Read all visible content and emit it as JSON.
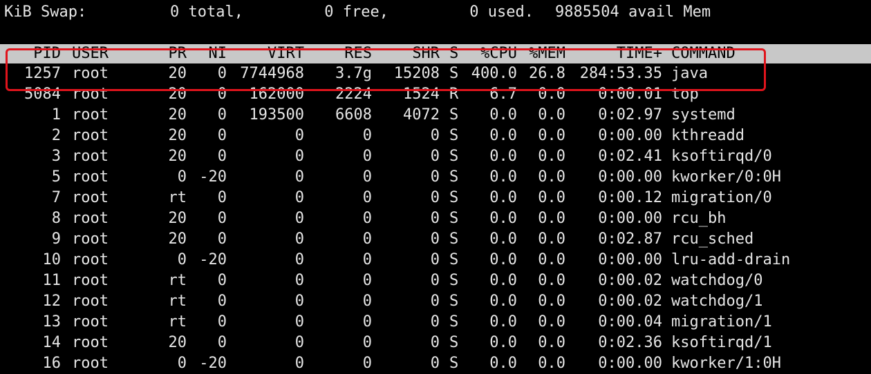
{
  "swap_summary": {
    "label": "KiB Swap:",
    "total": "0 total,",
    "free": "0 free,",
    "used": "0 used.",
    "avail": "9885504 avail Mem"
  },
  "columns": [
    "PID",
    "USER",
    "PR",
    "NI",
    "VIRT",
    "RES",
    "SHR",
    "S",
    "%CPU",
    "%MEM",
    "TIME+",
    "COMMAND"
  ],
  "processes": [
    [
      "1257",
      "root",
      "20",
      "0",
      "7744968",
      "3.7g",
      "15208",
      "S",
      "400.0",
      "26.8",
      "284:53.35",
      "java"
    ],
    [
      "5084",
      "root",
      "20",
      "0",
      "162000",
      "2224",
      "1524",
      "R",
      "6.7",
      "0.0",
      "0:00.01",
      "top"
    ],
    [
      "1",
      "root",
      "20",
      "0",
      "193500",
      "6608",
      "4072",
      "S",
      "0.0",
      "0.0",
      "0:02.97",
      "systemd"
    ],
    [
      "2",
      "root",
      "20",
      "0",
      "0",
      "0",
      "0",
      "S",
      "0.0",
      "0.0",
      "0:00.00",
      "kthreadd"
    ],
    [
      "3",
      "root",
      "20",
      "0",
      "0",
      "0",
      "0",
      "S",
      "0.0",
      "0.0",
      "0:02.41",
      "ksoftirqd/0"
    ],
    [
      "5",
      "root",
      "0",
      "-20",
      "0",
      "0",
      "0",
      "S",
      "0.0",
      "0.0",
      "0:00.00",
      "kworker/0:0H"
    ],
    [
      "7",
      "root",
      "rt",
      "0",
      "0",
      "0",
      "0",
      "S",
      "0.0",
      "0.0",
      "0:00.12",
      "migration/0"
    ],
    [
      "8",
      "root",
      "20",
      "0",
      "0",
      "0",
      "0",
      "S",
      "0.0",
      "0.0",
      "0:00.00",
      "rcu_bh"
    ],
    [
      "9",
      "root",
      "20",
      "0",
      "0",
      "0",
      "0",
      "S",
      "0.0",
      "0.0",
      "0:02.87",
      "rcu_sched"
    ],
    [
      "10",
      "root",
      "0",
      "-20",
      "0",
      "0",
      "0",
      "S",
      "0.0",
      "0.0",
      "0:00.00",
      "lru-add-drain"
    ],
    [
      "11",
      "root",
      "rt",
      "0",
      "0",
      "0",
      "0",
      "S",
      "0.0",
      "0.0",
      "0:00.02",
      "watchdog/0"
    ],
    [
      "12",
      "root",
      "rt",
      "0",
      "0",
      "0",
      "0",
      "S",
      "0.0",
      "0.0",
      "0:00.02",
      "watchdog/1"
    ],
    [
      "13",
      "root",
      "rt",
      "0",
      "0",
      "0",
      "0",
      "S",
      "0.0",
      "0.0",
      "0:00.04",
      "migration/1"
    ],
    [
      "14",
      "root",
      "20",
      "0",
      "0",
      "0",
      "0",
      "S",
      "0.0",
      "0.0",
      "0:02.36",
      "ksoftirqd/1"
    ],
    [
      "16",
      "root",
      "0",
      "-20",
      "0",
      "0",
      "0",
      "S",
      "0.0",
      "0.0",
      "0:00.00",
      "kworker/1:0H"
    ]
  ],
  "colors": {
    "background": "#000000",
    "text": "#e6e6e6",
    "header_background": "#c8c8c8",
    "header_text": "#000000",
    "highlight_border": "#e0141c"
  }
}
